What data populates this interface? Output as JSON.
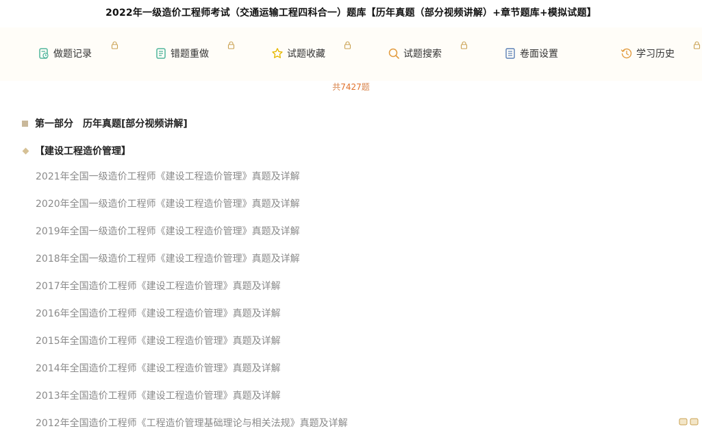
{
  "header": {
    "title": "2022年一级造价工程师考试（交通运输工程四科合一）题库【历年真题（部分视频讲解）+章节题库+模拟试题】"
  },
  "toolbar": {
    "items": [
      {
        "label": "做题记录",
        "icon": "clipboard-check-icon",
        "locked": true
      },
      {
        "label": "错题重做",
        "icon": "notebook-icon",
        "locked": true
      },
      {
        "label": "试题收藏",
        "icon": "star-icon",
        "locked": true
      },
      {
        "label": "试题搜索",
        "icon": "search-icon",
        "locked": true
      },
      {
        "label": "卷面设置",
        "icon": "document-icon",
        "locked": false
      },
      {
        "label": "学习历史",
        "icon": "clock-history-icon",
        "locked": true
      }
    ]
  },
  "summary": {
    "prefix": "共",
    "count": "7427",
    "suffix": "题"
  },
  "section": {
    "title": "第一部分　历年真题[部分视频讲解]"
  },
  "category": {
    "title": "【建设工程造价管理】"
  },
  "papers": [
    "2021年全国一级造价工程师《建设工程造价管理》真题及详解",
    "2020年全国一级造价工程师《建设工程造价管理》真题及详解",
    "2019年全国一级造价工程师《建设工程造价管理》真题及详解",
    "2018年全国一级造价工程师《建设工程造价管理》真题及详解",
    "2017年全国造价工程师《建设工程造价管理》真题及详解",
    "2016年全国造价工程师《建设工程造价管理》真题及详解",
    "2015年全国造价工程师《建设工程造价管理》真题及详解",
    "2014年全国造价工程师《建设工程造价管理》真题及详解",
    "2013年全国造价工程师《建设工程造价管理》真题及详解",
    "2012年全国造价工程师《工程造价管理基础理论与相关法规》真题及详解"
  ],
  "colors": {
    "accent": "#e0702a",
    "icon_green": "#4fb59a",
    "icon_yellow": "#e6b800",
    "icon_orange": "#e29a3c",
    "icon_blue": "#5a7fb5"
  }
}
